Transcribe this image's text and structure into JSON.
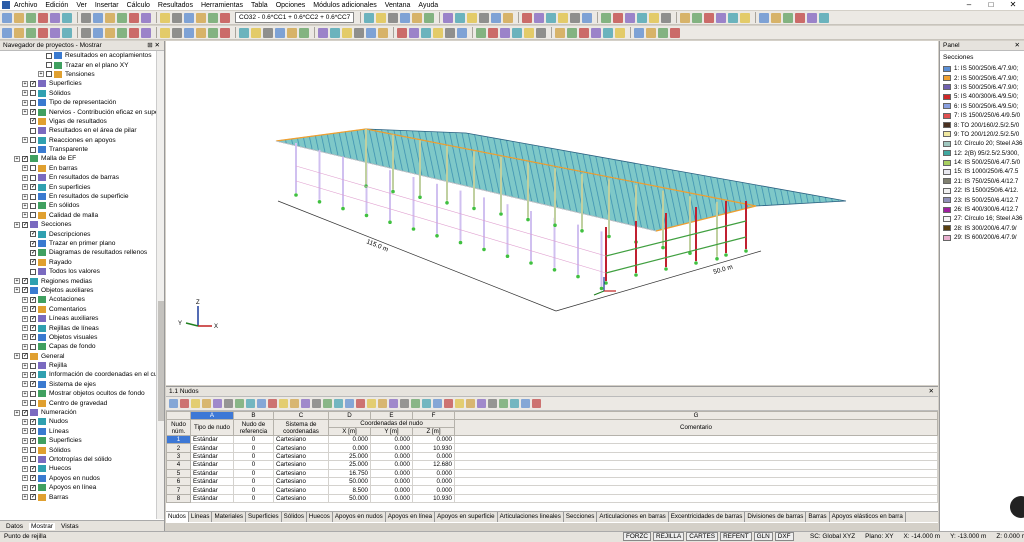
{
  "menu": [
    "Archivo",
    "Edición",
    "Ver",
    "Insertar",
    "Cálculo",
    "Resultados",
    "Herramientas",
    "Tabla",
    "Opciones",
    "Módulos adicionales",
    "Ventana",
    "Ayuda"
  ],
  "toolbar": {
    "load_combo": "CO32 - 0.6*CC1 + 0.6*CC2 + 0.6*CC7"
  },
  "navigator": {
    "title": "Navegador de proyectos - Mostrar",
    "items": [
      {
        "label": "Resultados en acoplamientos",
        "indent": 4,
        "chk": false
      },
      {
        "label": "Trazar en el plano XY",
        "indent": 4,
        "chk": false
      },
      {
        "label": "Tensiones",
        "indent": 4,
        "chk": false,
        "exp": true
      },
      {
        "label": "Superficies",
        "indent": 2,
        "chk": true,
        "exp": true
      },
      {
        "label": "Sólidos",
        "indent": 2,
        "chk": false,
        "exp": true
      },
      {
        "label": "Tipo de representación",
        "indent": 2,
        "chk": false,
        "exp": true
      },
      {
        "label": "Nervios - Contribución eficaz en superf",
        "indent": 2,
        "chk": true,
        "exp": true
      },
      {
        "label": "Vigas de resultados",
        "indent": 2,
        "chk": true
      },
      {
        "label": "Resultados en el área de pilar",
        "indent": 2,
        "chk": false
      },
      {
        "label": "Reacciones en apoyos",
        "indent": 2,
        "chk": false,
        "exp": true
      },
      {
        "label": "Transparente",
        "indent": 2,
        "chk": false
      },
      {
        "label": "Malla de EF",
        "indent": 1,
        "chk": true,
        "exp": true
      },
      {
        "label": "En barras",
        "indent": 2,
        "chk": false,
        "exp": true
      },
      {
        "label": "En resultados de barras",
        "indent": 2,
        "chk": false,
        "exp": true
      },
      {
        "label": "En superficies",
        "indent": 2,
        "chk": true,
        "exp": true
      },
      {
        "label": "En resultados de superficie",
        "indent": 2,
        "chk": false,
        "exp": true
      },
      {
        "label": "En sólidos",
        "indent": 2,
        "chk": false,
        "exp": true
      },
      {
        "label": "Calidad de malla",
        "indent": 2,
        "chk": false,
        "exp": true
      },
      {
        "label": "Secciones",
        "indent": 1,
        "chk": true,
        "exp": true
      },
      {
        "label": "Descripciones",
        "indent": 2,
        "chk": true
      },
      {
        "label": "Trazar en primer plano",
        "indent": 2,
        "chk": true
      },
      {
        "label": "Diagramas de resultados rellenos",
        "indent": 2,
        "chk": true
      },
      {
        "label": "Rayado",
        "indent": 2,
        "chk": true
      },
      {
        "label": "Todos los valores",
        "indent": 2,
        "chk": false
      },
      {
        "label": "Regiones medias",
        "indent": 1,
        "chk": true,
        "exp": true
      },
      {
        "label": "Objetos auxiliares",
        "indent": 1,
        "chk": true,
        "exp": true
      },
      {
        "label": "Acotaciones",
        "indent": 2,
        "chk": true,
        "exp": true
      },
      {
        "label": "Comentarios",
        "indent": 2,
        "chk": true,
        "exp": true
      },
      {
        "label": "Líneas auxiliares",
        "indent": 2,
        "chk": true,
        "exp": true
      },
      {
        "label": "Rejillas de líneas",
        "indent": 2,
        "chk": true,
        "exp": true
      },
      {
        "label": "Objetos visuales",
        "indent": 2,
        "chk": true,
        "exp": true
      },
      {
        "label": "Capas de fondo",
        "indent": 2,
        "chk": false,
        "exp": true
      },
      {
        "label": "General",
        "indent": 1,
        "chk": true,
        "exp": true
      },
      {
        "label": "Rejilla",
        "indent": 2,
        "chk": false,
        "exp": true
      },
      {
        "label": "Información de coordenadas en el curs",
        "indent": 2,
        "chk": true,
        "exp": true
      },
      {
        "label": "Sistema de ejes",
        "indent": 2,
        "chk": true,
        "exp": true
      },
      {
        "label": "Mostrar objetos ocultos de fondo",
        "indent": 2,
        "chk": false,
        "exp": true
      },
      {
        "label": "Centro de gravedad",
        "indent": 2,
        "chk": false,
        "exp": true
      },
      {
        "label": "Numeración",
        "indent": 1,
        "chk": true,
        "exp": true
      },
      {
        "label": "Nudos",
        "indent": 2,
        "chk": true,
        "exp": true
      },
      {
        "label": "Líneas",
        "indent": 2,
        "chk": true,
        "exp": true
      },
      {
        "label": "Superficies",
        "indent": 2,
        "chk": true,
        "exp": true
      },
      {
        "label": "Sólidos",
        "indent": 2,
        "chk": false,
        "exp": true
      },
      {
        "label": "Ortotropías del sólido",
        "indent": 2,
        "chk": false,
        "exp": true
      },
      {
        "label": "Huecos",
        "indent": 2,
        "chk": true,
        "exp": true
      },
      {
        "label": "Apoyos en nudos",
        "indent": 2,
        "chk": true,
        "exp": true
      },
      {
        "label": "Apoyos en línea",
        "indent": 2,
        "chk": true,
        "exp": true
      },
      {
        "label": "Barras",
        "indent": 2,
        "chk": true,
        "exp": true
      }
    ],
    "tabs": [
      "Datos",
      "Mostrar",
      "Vistas"
    ]
  },
  "panel": {
    "header": "Panel",
    "title": "Secciones",
    "sections": [
      {
        "label": "1: IS 500/250/6.4/7.9/0;",
        "color": "#5b8fd6"
      },
      {
        "label": "2: IS 500/250/6.4/7.9/0;",
        "color": "#f0a030"
      },
      {
        "label": "3: IS 500/250/6.4/7.9/0;",
        "color": "#7060b0"
      },
      {
        "label": "5: IS 400/300/6.4/9.5/0;",
        "color": "#d02828"
      },
      {
        "label": "6: IS 500/250/6.4/9.5/0;",
        "color": "#8aa0e0"
      },
      {
        "label": "7: IS 1500/250/6.4/9.5/0",
        "color": "#e05050"
      },
      {
        "label": "8: TO 200/160/2.5/2.5/0",
        "color": "#4a3020"
      },
      {
        "label": "9: TO 200/120/2.5/2.5/0",
        "color": "#f0e8a0"
      },
      {
        "label": "10: Círculo 20; Steel A36",
        "color": "#a0c8c0"
      },
      {
        "label": "12: 2(B) 95/2.5/2.5/300,",
        "color": "#40a8a0"
      },
      {
        "label": "14: IS 500/250/6.4/7.5/0",
        "color": "#a8d060"
      },
      {
        "label": "15: IS 1000/250/6.4/7.5",
        "color": "#e8e8f0"
      },
      {
        "label": "21: IS 750/250/6.4/12.7",
        "color": "#808070"
      },
      {
        "label": "22: IS 1500/250/6.4/12.",
        "color": "#f0f0f0"
      },
      {
        "label": "23: IS 500/250/6.4/12.7",
        "color": "#9090b8"
      },
      {
        "label": "26: IS 400/300/6.4/12.7",
        "color": "#a020a0"
      },
      {
        "label": "27: Círculo 16; Steel A36",
        "color": "#f8f8f8"
      },
      {
        "label": "28: IS 300/200/6.4/7.9/",
        "color": "#5a4010"
      },
      {
        "label": "29: IS 600/200/6.4/7.9/",
        "color": "#e8b0d0"
      }
    ]
  },
  "viewport": {
    "dim_long": "115.0 m",
    "dim_short": "50.0 m",
    "axis_x": "X",
    "axis_y": "Y",
    "axis_z": "Z"
  },
  "table": {
    "title": "1.1 Nudos",
    "col_letters": [
      "A",
      "B",
      "C",
      "D",
      "E",
      "F",
      "G"
    ],
    "headers": {
      "node": "Nudo núm.",
      "type": "Tipo de nudo",
      "ref": "Nudo de referencia",
      "coord_sys": "Sistema de coordenadas",
      "coords": "Coordenadas del nudo",
      "x": "X [m]",
      "y": "Y [m]",
      "z": "Z [m]",
      "comment": "Comentario"
    },
    "rows": [
      [
        "1",
        "Estándar",
        "0",
        "Cartesiano",
        "0.000",
        "0.000",
        "0.000"
      ],
      [
        "2",
        "Estándar",
        "0",
        "Cartesiano",
        "0.000",
        "0.000",
        "10.930"
      ],
      [
        "3",
        "Estándar",
        "0",
        "Cartesiano",
        "25.000",
        "0.000",
        "0.000"
      ],
      [
        "4",
        "Estándar",
        "0",
        "Cartesiano",
        "25.000",
        "0.000",
        "12.680"
      ],
      [
        "5",
        "Estándar",
        "0",
        "Cartesiano",
        "16.750",
        "0.000",
        "0.000"
      ],
      [
        "6",
        "Estándar",
        "0",
        "Cartesiano",
        "50.000",
        "0.000",
        "0.000"
      ],
      [
        "7",
        "Estándar",
        "0",
        "Cartesiano",
        "8.500",
        "0.000",
        "0.000"
      ],
      [
        "8",
        "Estándar",
        "0",
        "Cartesiano",
        "50.000",
        "0.000",
        "10.930"
      ]
    ],
    "tabs": [
      "Nudos",
      "Líneas",
      "Materiales",
      "Superficies",
      "Sólidos",
      "Huecos",
      "Apoyos en nudos",
      "Apoyos en línea",
      "Apoyos en superficie",
      "Articulaciones lineales",
      "Secciones",
      "Articulaciones en barras",
      "Excentricidades de barras",
      "Divisiones de barras",
      "Barras",
      "Apoyos elásticos en barra"
    ]
  },
  "status": {
    "left": "Punto de rejilla",
    "buttons": [
      "FORZC",
      "REJILLA",
      "CARTES",
      "REFENT",
      "GLN",
      "DXF"
    ],
    "sc": "SC: Global XYZ",
    "plane": "Plano: XY",
    "x": "X: -14.000 m",
    "y": "Y: -13.000 m",
    "z": "Z: 0.000 m"
  }
}
